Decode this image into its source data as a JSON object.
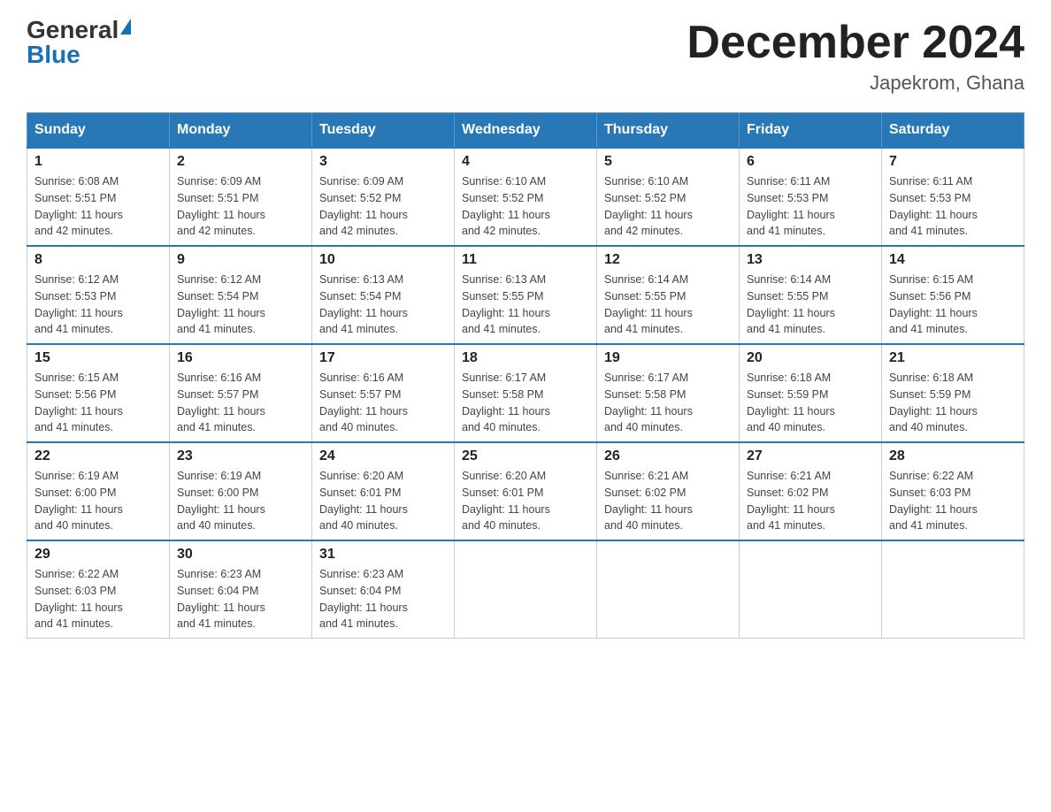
{
  "header": {
    "logo_general": "General",
    "logo_blue": "Blue",
    "month_title": "December 2024",
    "location": "Japekrom, Ghana"
  },
  "days_of_week": [
    "Sunday",
    "Monday",
    "Tuesday",
    "Wednesday",
    "Thursday",
    "Friday",
    "Saturday"
  ],
  "weeks": [
    [
      {
        "day": "1",
        "sunrise": "6:08 AM",
        "sunset": "5:51 PM",
        "daylight": "11 hours and 42 minutes."
      },
      {
        "day": "2",
        "sunrise": "6:09 AM",
        "sunset": "5:51 PM",
        "daylight": "11 hours and 42 minutes."
      },
      {
        "day": "3",
        "sunrise": "6:09 AM",
        "sunset": "5:52 PM",
        "daylight": "11 hours and 42 minutes."
      },
      {
        "day": "4",
        "sunrise": "6:10 AM",
        "sunset": "5:52 PM",
        "daylight": "11 hours and 42 minutes."
      },
      {
        "day": "5",
        "sunrise": "6:10 AM",
        "sunset": "5:52 PM",
        "daylight": "11 hours and 42 minutes."
      },
      {
        "day": "6",
        "sunrise": "6:11 AM",
        "sunset": "5:53 PM",
        "daylight": "11 hours and 41 minutes."
      },
      {
        "day": "7",
        "sunrise": "6:11 AM",
        "sunset": "5:53 PM",
        "daylight": "11 hours and 41 minutes."
      }
    ],
    [
      {
        "day": "8",
        "sunrise": "6:12 AM",
        "sunset": "5:53 PM",
        "daylight": "11 hours and 41 minutes."
      },
      {
        "day": "9",
        "sunrise": "6:12 AM",
        "sunset": "5:54 PM",
        "daylight": "11 hours and 41 minutes."
      },
      {
        "day": "10",
        "sunrise": "6:13 AM",
        "sunset": "5:54 PM",
        "daylight": "11 hours and 41 minutes."
      },
      {
        "day": "11",
        "sunrise": "6:13 AM",
        "sunset": "5:55 PM",
        "daylight": "11 hours and 41 minutes."
      },
      {
        "day": "12",
        "sunrise": "6:14 AM",
        "sunset": "5:55 PM",
        "daylight": "11 hours and 41 minutes."
      },
      {
        "day": "13",
        "sunrise": "6:14 AM",
        "sunset": "5:55 PM",
        "daylight": "11 hours and 41 minutes."
      },
      {
        "day": "14",
        "sunrise": "6:15 AM",
        "sunset": "5:56 PM",
        "daylight": "11 hours and 41 minutes."
      }
    ],
    [
      {
        "day": "15",
        "sunrise": "6:15 AM",
        "sunset": "5:56 PM",
        "daylight": "11 hours and 41 minutes."
      },
      {
        "day": "16",
        "sunrise": "6:16 AM",
        "sunset": "5:57 PM",
        "daylight": "11 hours and 41 minutes."
      },
      {
        "day": "17",
        "sunrise": "6:16 AM",
        "sunset": "5:57 PM",
        "daylight": "11 hours and 40 minutes."
      },
      {
        "day": "18",
        "sunrise": "6:17 AM",
        "sunset": "5:58 PM",
        "daylight": "11 hours and 40 minutes."
      },
      {
        "day": "19",
        "sunrise": "6:17 AM",
        "sunset": "5:58 PM",
        "daylight": "11 hours and 40 minutes."
      },
      {
        "day": "20",
        "sunrise": "6:18 AM",
        "sunset": "5:59 PM",
        "daylight": "11 hours and 40 minutes."
      },
      {
        "day": "21",
        "sunrise": "6:18 AM",
        "sunset": "5:59 PM",
        "daylight": "11 hours and 40 minutes."
      }
    ],
    [
      {
        "day": "22",
        "sunrise": "6:19 AM",
        "sunset": "6:00 PM",
        "daylight": "11 hours and 40 minutes."
      },
      {
        "day": "23",
        "sunrise": "6:19 AM",
        "sunset": "6:00 PM",
        "daylight": "11 hours and 40 minutes."
      },
      {
        "day": "24",
        "sunrise": "6:20 AM",
        "sunset": "6:01 PM",
        "daylight": "11 hours and 40 minutes."
      },
      {
        "day": "25",
        "sunrise": "6:20 AM",
        "sunset": "6:01 PM",
        "daylight": "11 hours and 40 minutes."
      },
      {
        "day": "26",
        "sunrise": "6:21 AM",
        "sunset": "6:02 PM",
        "daylight": "11 hours and 40 minutes."
      },
      {
        "day": "27",
        "sunrise": "6:21 AM",
        "sunset": "6:02 PM",
        "daylight": "11 hours and 41 minutes."
      },
      {
        "day": "28",
        "sunrise": "6:22 AM",
        "sunset": "6:03 PM",
        "daylight": "11 hours and 41 minutes."
      }
    ],
    [
      {
        "day": "29",
        "sunrise": "6:22 AM",
        "sunset": "6:03 PM",
        "daylight": "11 hours and 41 minutes."
      },
      {
        "day": "30",
        "sunrise": "6:23 AM",
        "sunset": "6:04 PM",
        "daylight": "11 hours and 41 minutes."
      },
      {
        "day": "31",
        "sunrise": "6:23 AM",
        "sunset": "6:04 PM",
        "daylight": "11 hours and 41 minutes."
      },
      null,
      null,
      null,
      null
    ]
  ],
  "labels": {
    "sunrise": "Sunrise:",
    "sunset": "Sunset:",
    "daylight": "Daylight:"
  }
}
